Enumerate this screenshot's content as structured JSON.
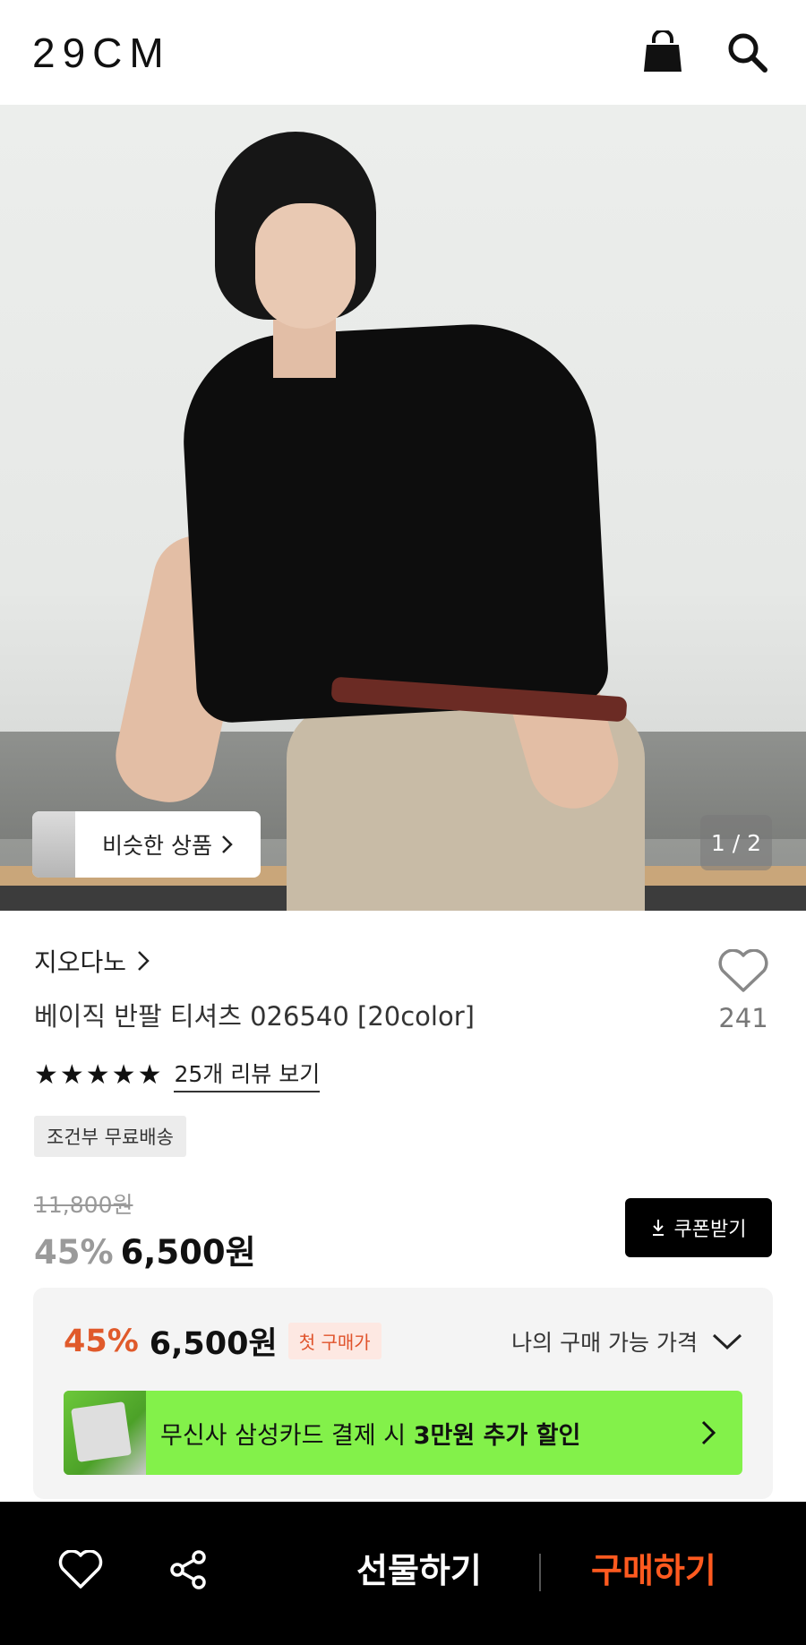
{
  "header": {
    "logo": "29CM",
    "icons": [
      "shopping-bag-icon",
      "search-icon"
    ]
  },
  "hero": {
    "similar_label": "비슷한 상품",
    "pager": "1 / 2"
  },
  "product": {
    "brand": "지오다노",
    "name": "베이직 반팔 티셔츠 026540 [20color]",
    "like_count": "241",
    "stars": "★★★★★",
    "rating_stars": 5,
    "review_link": "25개 리뷰 보기",
    "shipping_badge": "조건부 무료배송",
    "original_price": "11,800원",
    "discount": "45%",
    "price": "6,500원",
    "coupon_label": "쿠폰받기"
  },
  "offer": {
    "discount": "45%",
    "price": "6,500원",
    "first_purchase_badge": "첫 구매가",
    "my_price_label": "나의 구매 가능 가격",
    "banner_text_prefix": "무신사 삼성카드 결제 시 ",
    "banner_text_bold": "3만원 추가 할인"
  },
  "bottom_bar": {
    "gift_label": "선물하기",
    "buy_label": "구매하기"
  },
  "colors": {
    "accent_orange": "#ff5a1f",
    "discount_orange": "#e05a2b",
    "banner_green": "#83f14a",
    "black": "#000000"
  }
}
